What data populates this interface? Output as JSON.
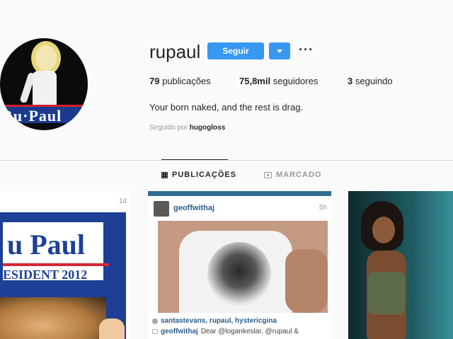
{
  "profile": {
    "username": "rupaul",
    "follow_label": "Seguir",
    "more_label": "···",
    "avatar_banner": "Ru·Paul",
    "stats": {
      "posts_count": "79",
      "posts_label": "publicações",
      "followers_count": "75,8mil",
      "followers_label": "seguidores",
      "following_count": "3",
      "following_label": "seguindo"
    },
    "bio": "Your born naked, and the rest is drag.",
    "followed_by_prefix": "Seguido por",
    "followed_by_user": "hugogloss"
  },
  "tabs": [
    {
      "label": "PUBLICAÇÕES",
      "active": true
    },
    {
      "label": "MARCADO",
      "active": false
    }
  ],
  "posts": {
    "p1": {
      "time": "1d",
      "sign_name": "u Paul",
      "sign_line2": "ESIDENT 2012"
    },
    "p2": {
      "user": "geoffwithaj",
      "time": "5h",
      "likes": "santastevans, rupaul, hystericgina",
      "comment_user": "geoffwithaj",
      "comment_text": "Dear @logankeslar, @rupaul &"
    }
  },
  "colors": {
    "accent": "#3897f0",
    "text": "#262626",
    "muted": "#999999",
    "background": "#fafafa"
  }
}
